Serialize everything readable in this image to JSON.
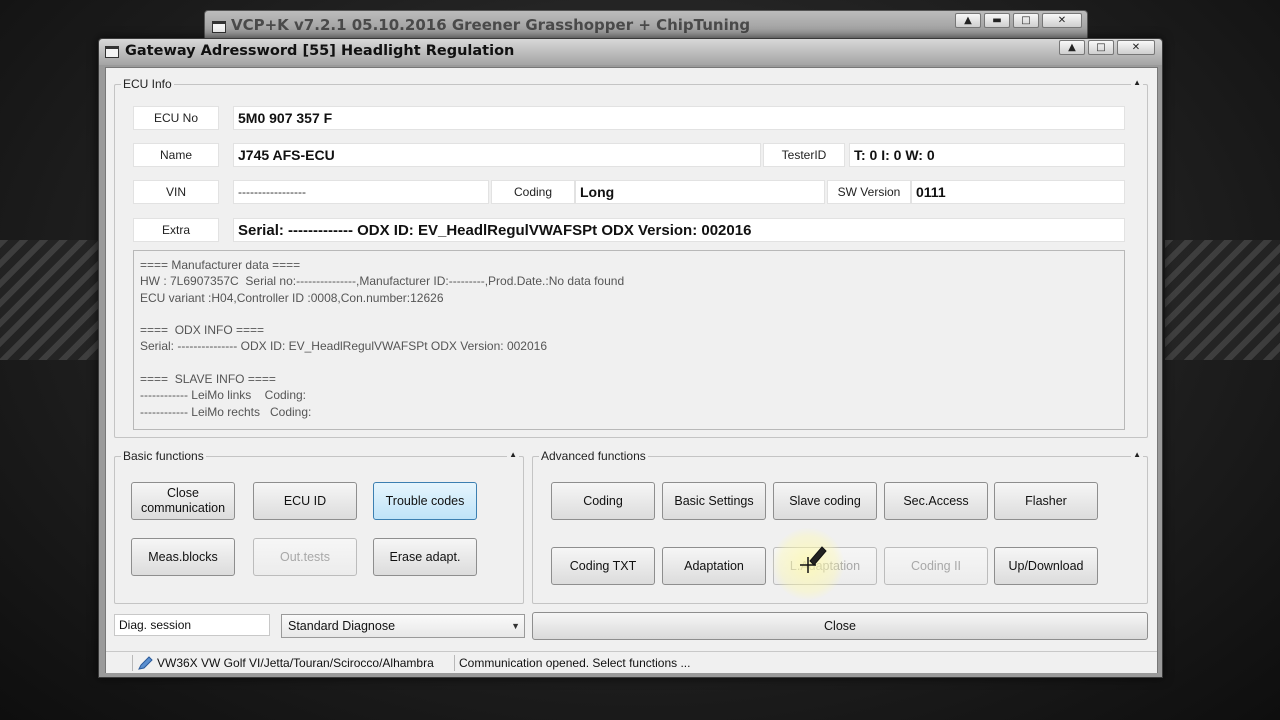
{
  "background_window": {
    "title": "VCP+K v7.2.1 05.10.2016 Greener Grasshopper + ChipTuning"
  },
  "window": {
    "title": "Gateway Adressword [55] Headlight Regulation"
  },
  "ecu_info": {
    "group_label": "ECU Info",
    "ecu_no_label": "ECU No",
    "ecu_no_value": "5M0 907 357 F",
    "name_label": "Name",
    "name_value": "J745  AFS-ECU",
    "testerid_label": "TesterID",
    "testerid_value": "T: 0 I: 0 W: 0",
    "vin_label": "VIN",
    "vin_value": "-----------------",
    "coding_label": "Coding",
    "coding_value": "Long",
    "sw_version_label": "SW Version",
    "sw_version_value": "0111",
    "extra_label": "Extra",
    "extra_value": "Serial: ------------- ODX ID: EV_HeadlRegulVWAFSPt ODX Version: 002016",
    "details": "==== Manufacturer data ====\nHW : 7L6907357C  Serial no:---------------,Manufacturer ID:---------,Prod.Date.:No data found\nECU variant :H04,Controller ID :0008,Con.number:12626\n\n====  ODX INFO ====\nSerial: --------------- ODX ID: EV_HeadlRegulVWAFSPt ODX Version: 002016\n\n====  SLAVE INFO ====\n------------ LeiMo links    Coding:\n------------ LeiMo rechts   Coding:"
  },
  "basic_functions": {
    "group_label": "Basic functions",
    "close_communication": "Close\ncommunication",
    "ecu_id": "ECU ID",
    "trouble_codes": "Trouble codes",
    "meas_blocks": "Meas.blocks",
    "out_tests": "Out.tests",
    "erase_adapt": "Erase adapt."
  },
  "advanced_functions": {
    "group_label": "Advanced functions",
    "coding": "Coding",
    "basic_settings": "Basic Settings",
    "slave_coding": "Slave coding",
    "sec_access": "Sec.Access",
    "flasher": "Flasher",
    "coding_txt": "Coding TXT",
    "adaptation": "Adaptation",
    "l_adaptation": "L.Adaptation",
    "coding_ii": "Coding II",
    "up_download": "Up/Download"
  },
  "footer": {
    "diag_session_label": "Diag. session",
    "diag_session_value": "Standard Diagnose",
    "close_button": "Close"
  },
  "statusbar": {
    "vehicle": "VW36X VW Golf VI/Jetta/Touran/Scirocco/Alhambra",
    "message": "Communication opened. Select functions ..."
  },
  "colors": {
    "active_button": "#bfe3f8",
    "window_background": "#f0f0f0"
  }
}
